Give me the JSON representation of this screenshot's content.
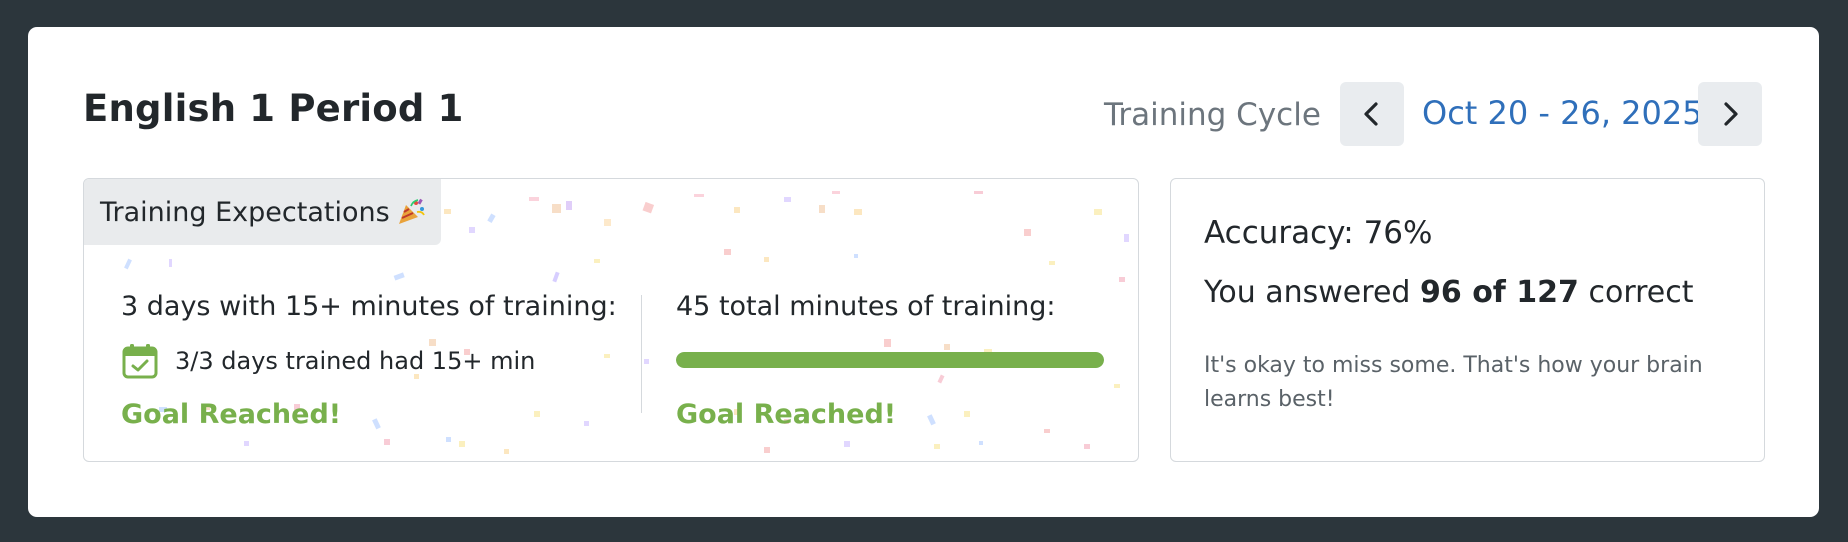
{
  "header": {
    "class_title": "English 1 Period 1",
    "cycle_label": "Training Cycle",
    "cycle_range": "Oct 20 - 26, 2025",
    "prev_icon": "chevron-left-icon",
    "next_icon": "chevron-right-icon"
  },
  "expectations": {
    "tab_label": "Training Expectations",
    "tab_icon": "party-popper-icon",
    "days_goal": {
      "heading": "3 days with 15+ minutes of training:",
      "icon": "calendar-check-icon",
      "detail": "3/3 days trained had 15+ min",
      "status": "Goal Reached!"
    },
    "minutes_goal": {
      "heading": "45 total minutes of training:",
      "progress_fraction": 1.0,
      "status": "Goal Reached!"
    }
  },
  "accuracy": {
    "heading": "Accuracy: 76%",
    "answered_prefix": "You answered",
    "answered_value": "96 of 127",
    "answered_suffix": "correct",
    "note": "It's okay to miss some. That's how your brain learns best!"
  },
  "colors": {
    "page_bg": "#2c363c",
    "accent_blue": "#2f6fba",
    "goal_green": "#78b04c",
    "tab_bg": "#e9ebed"
  }
}
